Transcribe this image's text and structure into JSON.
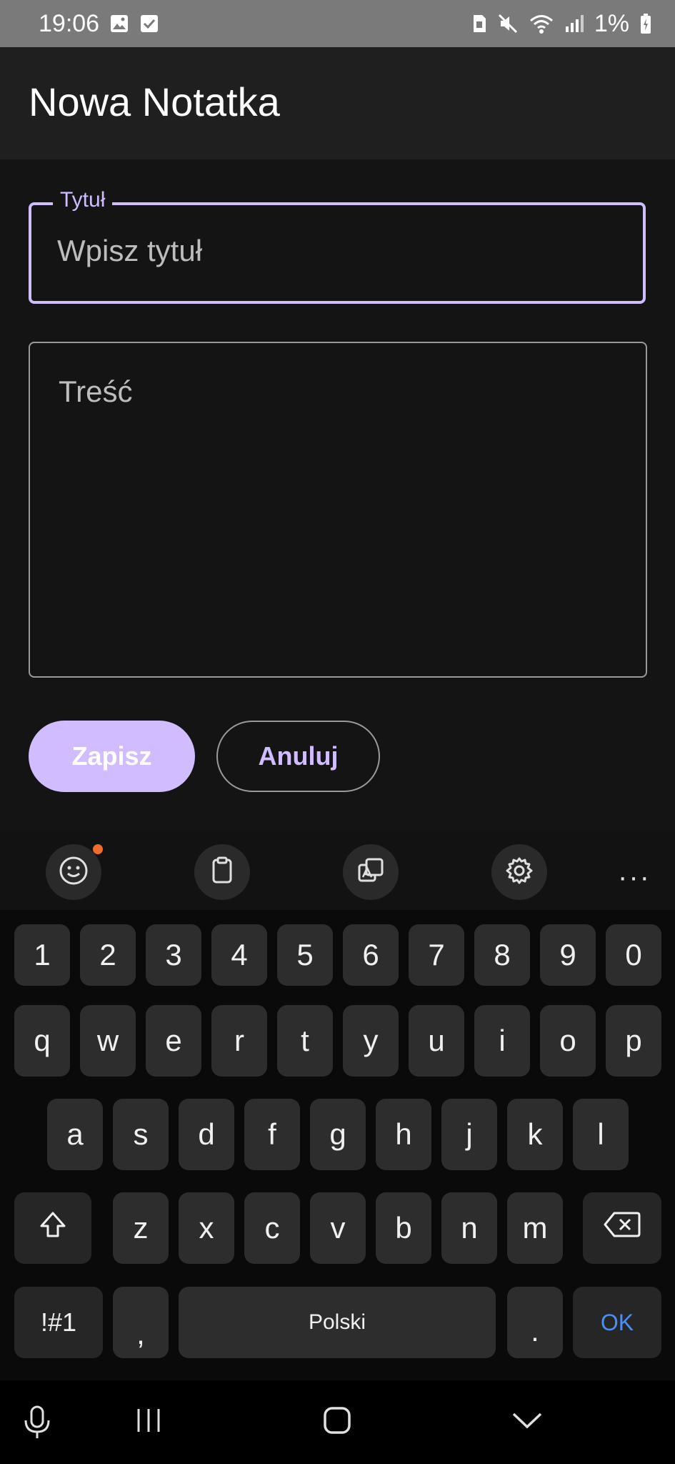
{
  "status_bar": {
    "time": "19:06",
    "battery": "1%",
    "icons_left": [
      "image-icon",
      "check-box-icon"
    ],
    "icons_right": [
      "sim-icon",
      "mute-icon",
      "wifi-icon",
      "signal-icon",
      "battery-icon"
    ]
  },
  "app_bar": {
    "title": "Nowa Notatka"
  },
  "form": {
    "title_label": "Tytuł",
    "title_placeholder": "Wpisz tytuł",
    "content_placeholder": "Treść",
    "save_label": "Zapisz",
    "cancel_label": "Anuluj"
  },
  "keyboard": {
    "toolbar": [
      "emoji-icon",
      "clipboard-icon",
      "translate-icon",
      "settings-icon",
      "more-icon"
    ],
    "more_label": "···",
    "row_numbers": [
      "1",
      "2",
      "3",
      "4",
      "5",
      "6",
      "7",
      "8",
      "9",
      "0"
    ],
    "row_1": [
      "q",
      "w",
      "e",
      "r",
      "t",
      "y",
      "u",
      "i",
      "o",
      "p"
    ],
    "row_2": [
      "a",
      "s",
      "d",
      "f",
      "g",
      "h",
      "j",
      "k",
      "l"
    ],
    "row_3": [
      "z",
      "x",
      "c",
      "v",
      "b",
      "n",
      "m"
    ],
    "symbols_label": "!#1",
    "comma_label": ",",
    "space_label": "Polski",
    "period_label": ".",
    "ok_label": "OK"
  },
  "colors": {
    "accent": "#d0bcff",
    "background": "#141414",
    "ok_blue": "#4a8ff6"
  }
}
